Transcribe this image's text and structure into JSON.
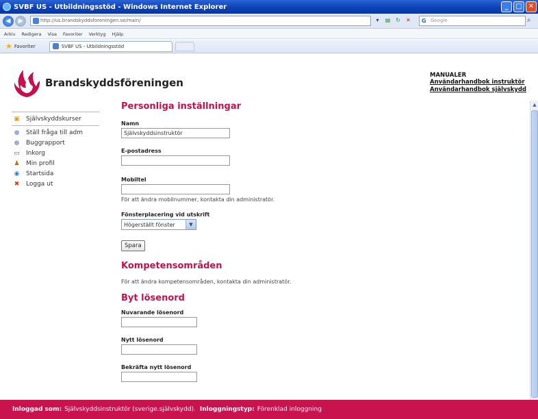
{
  "window": {
    "title": "SVBF US - Utbildningsstöd - Windows Internet Explorer",
    "address": "http://us.brandskyddsforeningen.se/main/",
    "search_placeholder": "Google"
  },
  "menu": [
    "Arkiv",
    "Redigera",
    "Visa",
    "Favoriter",
    "Verktyg",
    "Hjälp"
  ],
  "favorites": {
    "label": "Favoriter",
    "tab_title": "SVBF US - Utbildningsstöd"
  },
  "header": {
    "brand": "Brandskyddsföreningen",
    "manuals_title": "MANUALER",
    "manual_links": [
      "Användarhandbok instruktör",
      "Användarhandbok självskydd"
    ]
  },
  "sidebar": {
    "top_item": "Självskyddskurser",
    "items": [
      "Ställ fråga till adm",
      "Buggrapport",
      "Inkorg",
      "Min profil",
      "Startsida",
      "Logga ut"
    ]
  },
  "settings": {
    "heading": "Personliga inställningar",
    "name_label": "Namn",
    "name_value": "Självskyddsinstruktör",
    "email_label": "E-postadress",
    "email_value": "",
    "mobile_label": "Mobiltel",
    "mobile_value": "",
    "mobile_help": "För att ändra mobilnummer, kontakta din administratör.",
    "print_label": "Fönsterplacering vid utskrift",
    "print_value": "Högerställt fönster",
    "save_label": "Spara"
  },
  "competence": {
    "heading": "Kompetensområden",
    "help": "För att ändra kompetensområden, kontakta din administratör."
  },
  "password": {
    "heading": "Byt lösenord",
    "current_label": "Nuvarande lösenord",
    "new_label": "Nytt lösenord",
    "confirm_label": "Bekräfta nytt lösenord"
  },
  "status": {
    "logged_in_label": "Inloggad som:",
    "logged_in_value": "Självskyddsinstruktör (sverige.självskydd).",
    "login_type_label": "Inloggningstyp:",
    "login_type_value": "Förenklad inloggning"
  },
  "colors": {
    "accent": "#c4114e",
    "statusbar": "#c8134f"
  }
}
